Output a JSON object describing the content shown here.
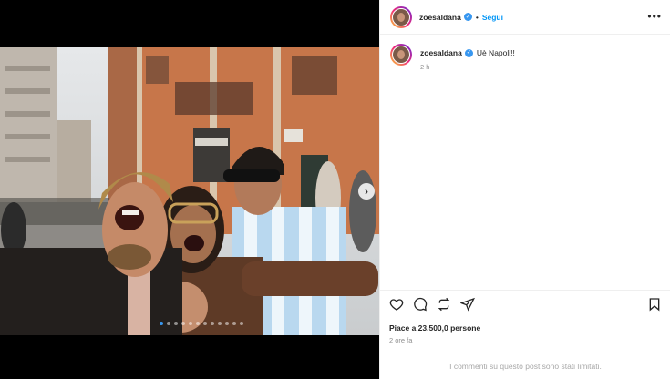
{
  "post": {
    "username": "zoesaldana",
    "follow_label": "Segui",
    "separator": "•",
    "verified_mark": "✓",
    "more_label": "•••",
    "caption": {
      "text": "Uè Napoli!!",
      "time": "2 h"
    },
    "likes": "Piace a 23.500,0 persone",
    "timestamp": "2 ore fa",
    "comments_notice": "I commenti su questo post sono stati limitati.",
    "carousel": {
      "next_label": "›",
      "slide_count": 12,
      "active_slide": 1
    },
    "icons": {
      "like": "heart-icon",
      "comment": "comment-bubble-icon",
      "share": "repost-icon",
      "send": "send-icon",
      "save": "bookmark-icon"
    },
    "colors": {
      "accent": "#0095f6",
      "verified": "#3897f0",
      "text": "#262626",
      "muted": "#8e8e8e"
    }
  }
}
